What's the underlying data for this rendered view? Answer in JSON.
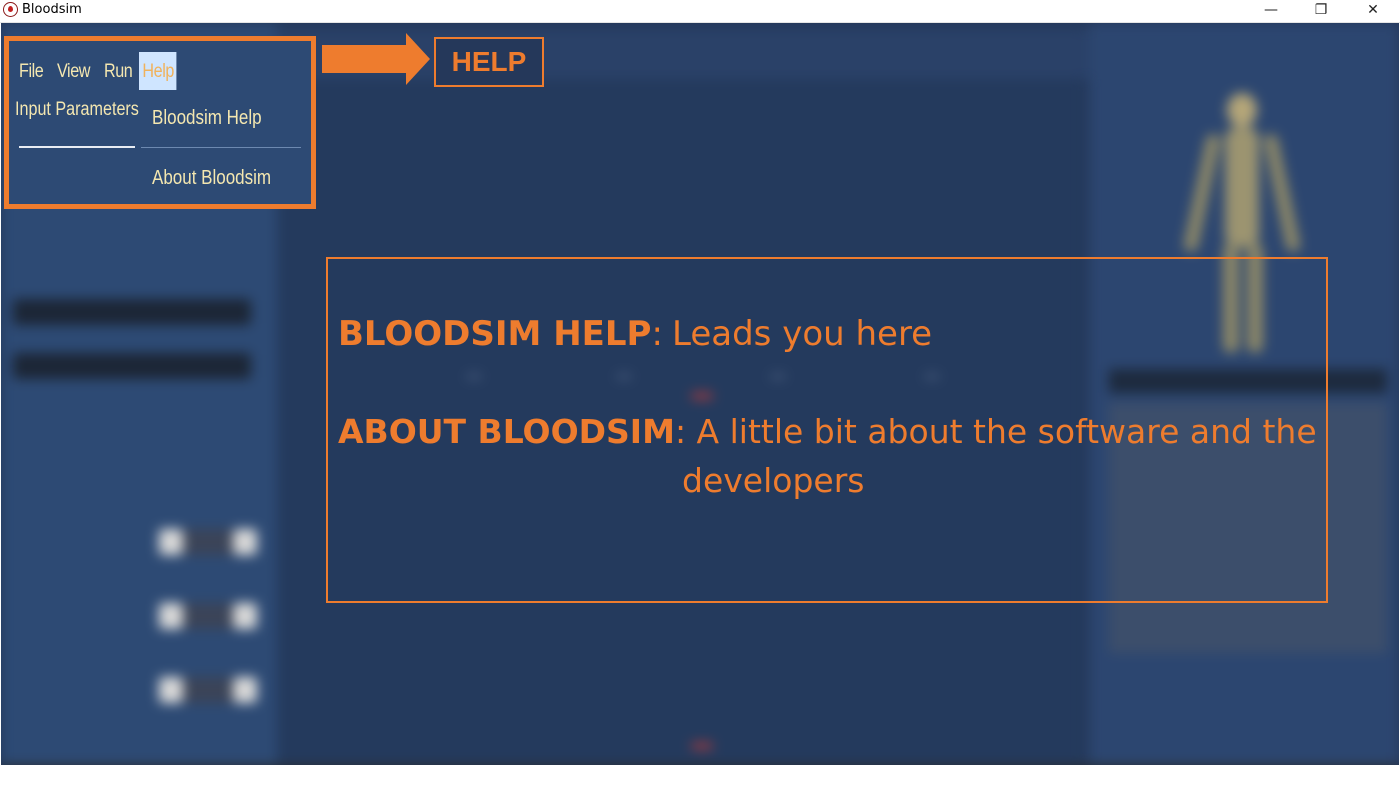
{
  "window": {
    "title": "Bloodsim",
    "minimize_glyph": "—",
    "maximize_glyph": "❐",
    "close_glyph": "✕"
  },
  "menubar": {
    "items": [
      {
        "label": "File"
      },
      {
        "label": "View"
      },
      {
        "label": "Run"
      },
      {
        "label": "Help"
      }
    ],
    "submenu_left": "Input Parameters"
  },
  "help_menu": {
    "items": [
      {
        "label": "Bloodsim Help"
      },
      {
        "label": "About Bloodsim"
      }
    ]
  },
  "callout": {
    "label": "HELP"
  },
  "info": {
    "help_heading": "BLOODSIM HELP",
    "help_sep": ":",
    "help_desc": "Leads you here",
    "about_heading": "ABOUT BLOODSIM",
    "about_sep": ":",
    "about_desc_1": " A little bit about the software and the",
    "about_desc_2": "developers"
  },
  "colors": {
    "accent": "#ee7c2e",
    "menu_text": "#f4e7b0",
    "app_bg": "#25385a",
    "panel_bg": "#2d4a74"
  }
}
